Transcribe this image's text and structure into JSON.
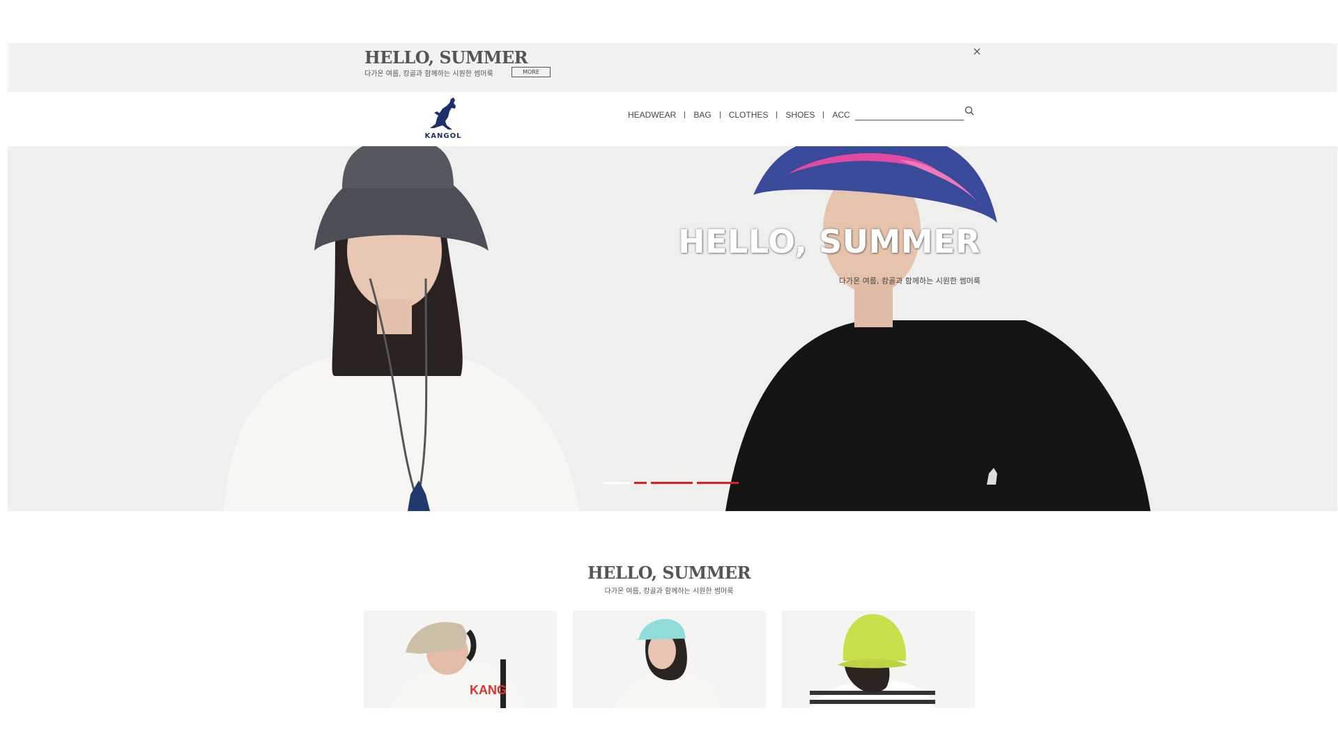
{
  "promo": {
    "title": "HELLO, SUMMER",
    "subtitle": "다가온 여름, 캉골과 함께하는 시원한 썸머룩",
    "more_label": "MORE",
    "close_icon": "×"
  },
  "header": {
    "logo_text": "KANGOL",
    "nav": [
      "HEADWEAR",
      "BAG",
      "CLOTHES",
      "SHOES",
      "ACC"
    ],
    "search": {
      "placeholder": "",
      "value": ""
    }
  },
  "hero": {
    "title": "HELLO, SUMMER",
    "subtitle": "다가온 여름, 캉골과 함께하는 시원한 썸머룩",
    "slides": 4,
    "active_slide": 1
  },
  "section": {
    "title": "HELLO, SUMMER",
    "subtitle": "다가온 여름, 캉골과 함께하는 시원한 썸머룩",
    "products": [
      {
        "hat_color": "#cbbfa8",
        "shirt_text": "KANG"
      },
      {
        "hat_color": "#8fdcd8",
        "shirt_text": ""
      },
      {
        "hat_color": "#c9e04a",
        "shirt_text": ""
      }
    ]
  },
  "colors": {
    "accent": "#e02020",
    "banner_bg": "#f2f2f2",
    "logo": "#1f2f6b"
  }
}
